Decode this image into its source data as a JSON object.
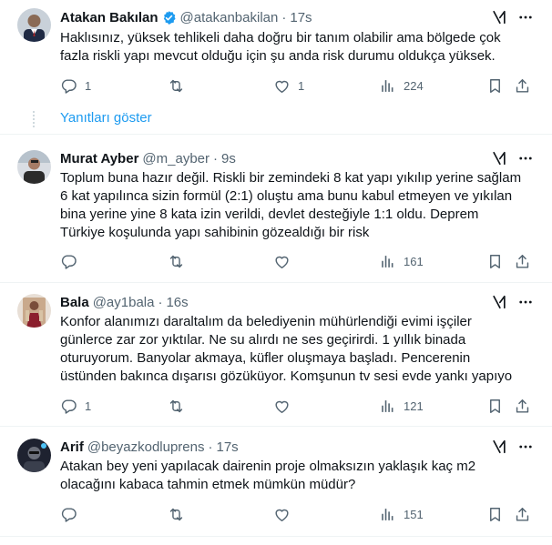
{
  "tweets": [
    {
      "name": "Atakan Bakılan",
      "handle": "@atakanbakilan",
      "sep": "·",
      "time": "17s",
      "verified": true,
      "avatar": "man-in-suit-avatar",
      "text": "Haklısınız, yüksek tehlikeli daha doğru bir tanım olabilir ama bölgede çok\nfazla riskli yapı mevcut olduğu için şu anda risk durumu oldukça yüksek.",
      "replies": "1",
      "retweets": "",
      "likes": "1",
      "views": "224"
    },
    {
      "name": "Murat Ayber",
      "handle": "@m_ayber",
      "sep": "·",
      "time": "9s",
      "verified": false,
      "avatar": "man-photo-avatar",
      "text": "Toplum buna hazır değil. Riskli bir zemindeki 8 kat yapı yıkılıp yerine sağlam\n6 kat yapılınca sizin formül (2:1) oluştu ama bunu kabul etmeyen ve yıkılan\nbina yerine yine 8 kata izin verildi, devlet desteğiyle 1:1 oldu. Deprem\nTürkiye koşulunda yapı sahibinin gözealdığı bir risk",
      "replies": "",
      "retweets": "",
      "likes": "",
      "views": "161"
    },
    {
      "name": "Bala",
      "handle": "@ay1bala",
      "sep": "·",
      "time": "16s",
      "verified": false,
      "avatar": "figure-photo-avatar",
      "text": "Konfor alanımızı daraltalım da belediyenin mühürlendiği evimi işçiler\ngünlerce zar zor yıktılar. Ne su alırdı ne ses geçirirdi. 1 yıllık binada\noturuyorum. Banyolar akmaya, küfler oluşmaya başladı. Pencerenin\nüstünden bakınca dışarısı gözüküyor. Komşunun tv sesi evde yankı yapıyo",
      "replies": "1",
      "retweets": "",
      "likes": "",
      "views": "121"
    },
    {
      "name": "Arif",
      "handle": "@beyazkodluprens",
      "sep": "·",
      "time": "17s",
      "verified": false,
      "avatar": "dark-photo-avatar",
      "text": "Atakan bey yeni yapılacak dairenin proje olmaksızın yaklaşık kaç m2\nolacağını kabaca tahmin etmek mümkün müdür?",
      "replies": "",
      "retweets": "",
      "likes": "",
      "views": "151"
    }
  ],
  "show_replies": "Yanıtları göster",
  "colors": {
    "text": "#0f1419",
    "secondary": "#536471",
    "accent": "#1d9bf0",
    "divider": "#eff3f4"
  }
}
